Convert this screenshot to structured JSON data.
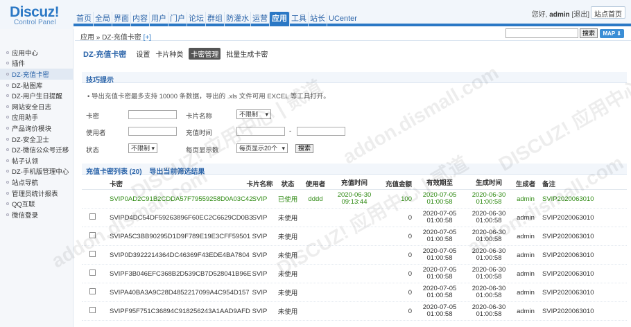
{
  "logo": {
    "name": "Discuz!",
    "sub": "Control Panel"
  },
  "topnav": [
    "首页",
    "全局",
    "界面",
    "内容",
    "用户",
    "门户",
    "论坛",
    "群组",
    "防灌水",
    "运营",
    "应用",
    "工具",
    "站长",
    "UCenter"
  ],
  "topnav_active": 10,
  "user": {
    "greeting": "您好,",
    "name": "admin",
    "logout": "[退出]",
    "site_home": "站点首页"
  },
  "crumb": {
    "path": "应用 » DZ-充值卡密",
    "add": "[+]"
  },
  "search": {
    "button": "搜索",
    "map": "MAP ⬇"
  },
  "sidebar": [
    "应用中心",
    "插件",
    "DZ-充值卡密",
    "DZ-贴图库",
    "DZ-用户生日提醒",
    "网站安全日志",
    "应用助手",
    "产品询价模块",
    "DZ-安全卫士",
    "DZ-微信公众号迁移",
    "帖子认领",
    "DZ-手机版管理中心",
    "站点导航",
    "管理员统计报表",
    "QQ互联",
    "微信登录"
  ],
  "sidebar_active": 2,
  "page": {
    "title": "DZ-充值卡密",
    "tabs": [
      "设置",
      "卡片种类",
      "卡密管理",
      "批量生成卡密"
    ],
    "active_tab": 2
  },
  "tips": {
    "title": "技巧提示",
    "text": "• 导出充值卡密最多支持 10000 条数据，导出的 .xls 文件可用 EXCEL 等工具打开。"
  },
  "filters": {
    "card": "卡密",
    "card_name": "卡片名称",
    "card_name_value": "不限制",
    "user": "使用者",
    "recharge_time": "充值时间",
    "dash": "-",
    "status": "状态",
    "status_value": "不限制",
    "per_page": "每页显示数",
    "per_page_value": "每页显示20个",
    "search": "搜索"
  },
  "list": {
    "title": "充值卡密列表 (20)",
    "export": "导出当前筛选结果"
  },
  "columns": [
    "卡密",
    "卡片名称",
    "状态",
    "使用者",
    "充值时间",
    "充值金额",
    "有效期至",
    "生成时间",
    "生成者",
    "备注"
  ],
  "rows": [
    {
      "code": "SVIP0AD2C91B2CDDA57F79559258D0A03C42",
      "name": "SVIP",
      "status": "已使用",
      "user": "dddd",
      "rtime1": "2020-06-30",
      "rtime2": "09:13:44",
      "amount": "100",
      "exp1": "2020-07-05",
      "exp2": "01:00:58",
      "gen1": "2020-06-30",
      "gen2": "01:00:58",
      "creator": "admin",
      "note": "SVIP2020063010",
      "used": true
    },
    {
      "code": "SVIPD4DC54DF59263896F60EC2C6629CD0B3",
      "name": "SVIP",
      "status": "未使用",
      "user": "",
      "rtime1": "",
      "rtime2": "",
      "amount": "0",
      "exp1": "2020-07-05",
      "exp2": "01:00:58",
      "gen1": "2020-06-30",
      "gen2": "01:00:58",
      "creator": "admin",
      "note": "SVIP2020063010",
      "used": false
    },
    {
      "code": "SVIPA5C3BB90295D1D9F789E19E3CFF59501",
      "name": "SVIP",
      "status": "未使用",
      "user": "",
      "rtime1": "",
      "rtime2": "",
      "amount": "0",
      "exp1": "2020-07-05",
      "exp2": "01:00:58",
      "gen1": "2020-06-30",
      "gen2": "01:00:58",
      "creator": "admin",
      "note": "SVIP2020063010",
      "used": false
    },
    {
      "code": "SVIP0D3922214364DC46369F43EDE4BA7804",
      "name": "SVIP",
      "status": "未使用",
      "user": "",
      "rtime1": "",
      "rtime2": "",
      "amount": "0",
      "exp1": "2020-07-05",
      "exp2": "01:00:58",
      "gen1": "2020-06-30",
      "gen2": "01:00:58",
      "creator": "admin",
      "note": "SVIP2020063010",
      "used": false
    },
    {
      "code": "SVIPF3B046EFC368B2D539CB7D528041B96E",
      "name": "SVIP",
      "status": "未使用",
      "user": "",
      "rtime1": "",
      "rtime2": "",
      "amount": "0",
      "exp1": "2020-07-05",
      "exp2": "01:00:58",
      "gen1": "2020-06-30",
      "gen2": "01:00:58",
      "creator": "admin",
      "note": "SVIP2020063010",
      "used": false
    },
    {
      "code": "SVIPA40BA3A9C28D4852217099A4C954D157",
      "name": "SVIP",
      "status": "未使用",
      "user": "",
      "rtime1": "",
      "rtime2": "",
      "amount": "0",
      "exp1": "2020-07-05",
      "exp2": "01:00:58",
      "gen1": "2020-06-30",
      "gen2": "01:00:58",
      "creator": "admin",
      "note": "SVIP2020063010",
      "used": false
    },
    {
      "code": "SVIPF95F751C36894C918256243A1AAD9AFD",
      "name": "SVIP",
      "status": "未使用",
      "user": "",
      "rtime1": "",
      "rtime2": "",
      "amount": "0",
      "exp1": "2020-07-05",
      "exp2": "01:00:58",
      "gen1": "2020-06-30",
      "gen2": "01:00:58",
      "creator": "admin",
      "note": "SVIP2020063010",
      "used": false
    }
  ],
  "watermark": [
    "DISCUZ! 应用中心 | 贰道",
    "addon.dismall.com"
  ],
  "colors": {
    "brand": "#2b78c5",
    "accent": "#f39800",
    "used": "#2f8a13"
  }
}
